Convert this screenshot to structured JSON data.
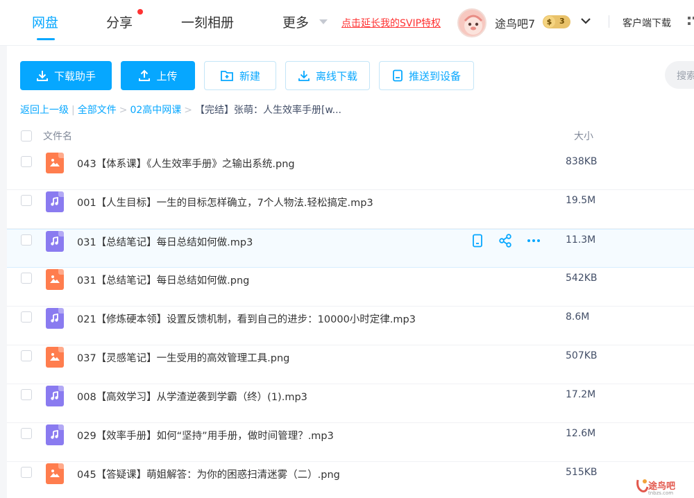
{
  "nav": {
    "tabs": [
      "网盘",
      "分享",
      "一刻相册",
      "更多"
    ],
    "svip_link": "点击延长我的SVIP特权",
    "username": "途鸟吧7",
    "vip_coin": "$",
    "vip_level": "3",
    "client_download": "客户端下载"
  },
  "toolbar": {
    "download_helper": "下载助手",
    "upload": "上传",
    "new": "新建",
    "offline_download": "离线下载",
    "push_device": "推送到设备",
    "search_placeholder": "搜索"
  },
  "breadcrumb": {
    "back": "返回上一级",
    "all_files": "全部文件",
    "folder": "02高中网课",
    "current": "【完结】张萌：人生效率手册[w..."
  },
  "table": {
    "col_name": "文件名",
    "col_size": "大小",
    "rows": [
      {
        "type": "img",
        "name": "043【体系课】《人生效率手册》之输出系统.png",
        "size": "838KB"
      },
      {
        "type": "audio",
        "name": "001【人生目标】一生的目标怎样确立，7个人物法.轻松搞定.mp3",
        "size": "19.5M"
      },
      {
        "type": "audio",
        "name": "031【总结笔记】每日总结如何做.mp3",
        "size": "11.3M"
      },
      {
        "type": "img",
        "name": "031【总结笔记】每日总结如何做.png",
        "size": "542KB"
      },
      {
        "type": "audio",
        "name": "021【修炼硬本领】设置反馈机制，看到自己的进步：10000小时定律.mp3",
        "size": "8.6M"
      },
      {
        "type": "img",
        "name": "037【灵感笔记】一生受用的高效管理工具.png",
        "size": "507KB"
      },
      {
        "type": "audio",
        "name": "008【高效学习】从学渣逆袭到学霸（终）(1).mp3",
        "size": "17.2M"
      },
      {
        "type": "audio",
        "name": "029【效率手册】如何“坚持”用手册，做时间管理？.mp3",
        "size": "12.6M"
      },
      {
        "type": "img",
        "name": "045【答疑课】萌姐解答：为你的困惑扫清迷雾（二）.png",
        "size": "515KB"
      }
    ]
  },
  "watermark": {
    "text": "途鸟吧",
    "sub": "tnbzs.com"
  },
  "colors": {
    "accent": "#06a7ff",
    "image_icon": "#ff7d4e",
    "audio_icon": "#8a7bf0",
    "svip": "#ff3333"
  }
}
